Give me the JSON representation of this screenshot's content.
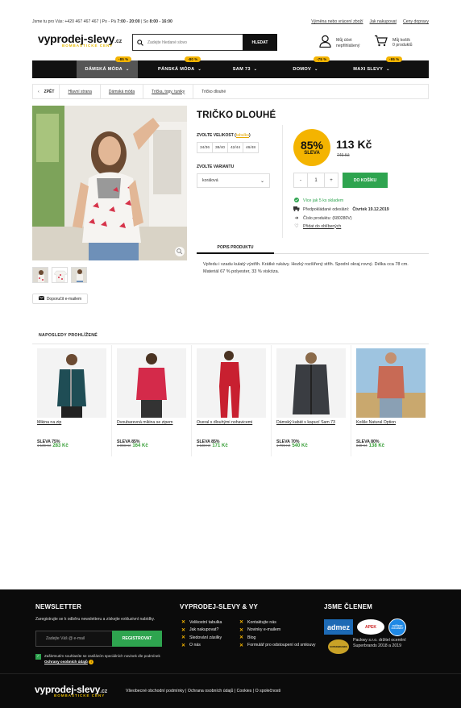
{
  "topbar": {
    "contact": "Jsme tu pro Vás: +420 467 467 467 | Po - Pá",
    "hours1": "7:00 - 20:00",
    "sat": "So",
    "hours2": "8:00 - 16:00",
    "links": [
      "Výměna nebo vrácení zboží",
      "Jak nakupovat",
      "Ceny dopravy"
    ]
  },
  "header": {
    "logo": "vyprodej-slevy",
    "logo_tld": ".cz",
    "tagline": "BOMBASTICKÉ CENY",
    "search_placeholder": "Zadejte hledané slovo",
    "search_button": "HLEDAT",
    "account_line1": "Můj účet",
    "account_line2": "nepřihlášený",
    "cart_line1": "Můj košík",
    "cart_line2": "0 produktů"
  },
  "nav": [
    {
      "label": "DÁMSKÁ MÓDA",
      "badge": "-85 %",
      "active": true
    },
    {
      "label": "PÁNSKÁ MÓDA",
      "badge": "-80 %",
      "active": false
    },
    {
      "label": "SAM 73",
      "badge": "",
      "active": false
    },
    {
      "label": "DOMOV",
      "badge": "-75 %",
      "active": false
    },
    {
      "label": "MAXI SLEVY",
      "badge": "-95 %",
      "active": false
    }
  ],
  "breadcrumb": {
    "back": "ZPĚT",
    "items": [
      "Hlavní strana",
      "Dámská móda",
      "Trička, topy, tuniky",
      "Tričko dlouhé"
    ]
  },
  "product": {
    "title": "TRIČKO DLOUHÉ",
    "size_label": "ZVOLTE VELIKOST",
    "size_table": "tabulka",
    "sizes": [
      "34/36",
      "38/40",
      "42/44",
      "46/48"
    ],
    "variant_label": "ZVOLTE VARIANTU",
    "variant_value": "korálová",
    "discount": "85%",
    "discount_label": "SLEVA",
    "price": "113 Kč",
    "old_price": "749 Kč",
    "qty": "1",
    "qty_minus": "-",
    "qty_plus": "+",
    "add_to_cart": "DO KOŠÍKU",
    "stock": "Více jak 5 ks skladem",
    "delivery_label": "Předpokládané odeslání:",
    "delivery_date": "Čtvrtek 19.12.2019",
    "product_no": "Číslo produktu: (680280V)",
    "favorite": "Přidat do oblíbených",
    "tab": "POPIS PRODUKTU",
    "description": "Vpředu i vzadu kulatý výstřih. Krátké rukávy. Hezký rozšířený střih. Spodní okraj rovný. Délka cca 78 cm. Materiál 67 % polyester, 33 % viskóza.",
    "recommend": "Doporučit e-mailem"
  },
  "recent": {
    "title": "NAPOSLEDY PROHLÍŽENÉ",
    "items": [
      {
        "name": "Mikina na zip",
        "discount": "SLEVA 75%",
        "old": "1 139 Kč",
        "price": "283 Kč"
      },
      {
        "name": "Dvoubarevná mikina se zipem",
        "discount": "SLEVA 85%",
        "old": "1 098 Kč",
        "price": "164 Kč"
      },
      {
        "name": "Overal s dlouhými nohavicemi",
        "discount": "SLEVA 85%",
        "old": "1 138 Kč",
        "price": "171 Kč"
      },
      {
        "name": "Dámský kabát s kapucí Sam 73",
        "discount": "SLEVA 70%",
        "old": "1 799 Kč",
        "price": "540 Kč"
      },
      {
        "name": "Košile Natural Option",
        "discount": "SLEVA 80%",
        "old": "849 Kč",
        "price": "138 Kč"
      }
    ]
  },
  "footer": {
    "newsletter_title": "NEWSLETTER",
    "newsletter_text": "Zaregistrujte se k odběru newsletteru a získejte exkluzivní nabídky.",
    "email_placeholder": "Zadejte Váš @ e-mail",
    "register": "REGISTROVAT",
    "consent1": "Zaškrtnutím souhlasíte se zasíláním speciálních novinek dle podmínek",
    "consent_link": "Ochrany osobních údajů",
    "col2_title": "VYPRODEJ-SLEVY & VY",
    "col2_left": [
      "Velikostní tabulka",
      "Jak nakupovat?",
      "Sledování zásilky",
      "O nás"
    ],
    "col2_right": [
      "Kontaktujte nás",
      "Novinky e-mailem",
      "Blog",
      "Formulář pro odstoupení od smlouvy"
    ],
    "col3_title": "JSME ČLENEM",
    "badge1": "admez",
    "badge2": "APEK",
    "badge3": "OVĚŘENO ZÁKAZNÍKY",
    "badge4": "SUPERBRANDS",
    "packwy": "Packwy s.r.o. držitel ocenění Superbrands 2018 a 2019",
    "bottom_links": "Všeobecné obchodní podmínky | Ochrana osobních údajů | Cookies | O společnosti"
  },
  "colors": {
    "accent": "#f4b400",
    "green": "#2ea44f",
    "dark": "#111111"
  }
}
